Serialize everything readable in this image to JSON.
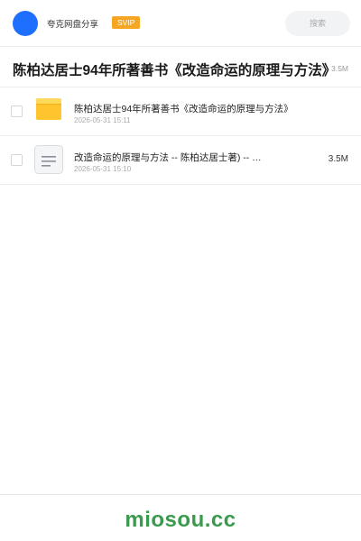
{
  "header": {
    "username": "夸克网盘分享",
    "badge": "SVIP",
    "search_placeholder": "搜索"
  },
  "title": {
    "text": "陈柏达居士94年所著善书《改造命运的原理与方法》",
    "meta": "个 · 3.5M"
  },
  "files": [
    {
      "icon": "folder-icon",
      "name": "陈柏达居士94年所著善书《改造命运的原理与方法》",
      "date": "2026-05-31 15:11",
      "size": ""
    },
    {
      "icon": "document-icon",
      "name": "改造命运的原理与方法 -- 陈柏达居士著) -- …",
      "date": "2026-05-31 15:10",
      "size": "3.5M"
    }
  ],
  "footer": {
    "watermark": "miosou.cc"
  },
  "colors": {
    "avatar": "#1f6fff",
    "badge": "#f5a623",
    "folder": "#ffc42e",
    "watermark": "#3a9a4e"
  }
}
